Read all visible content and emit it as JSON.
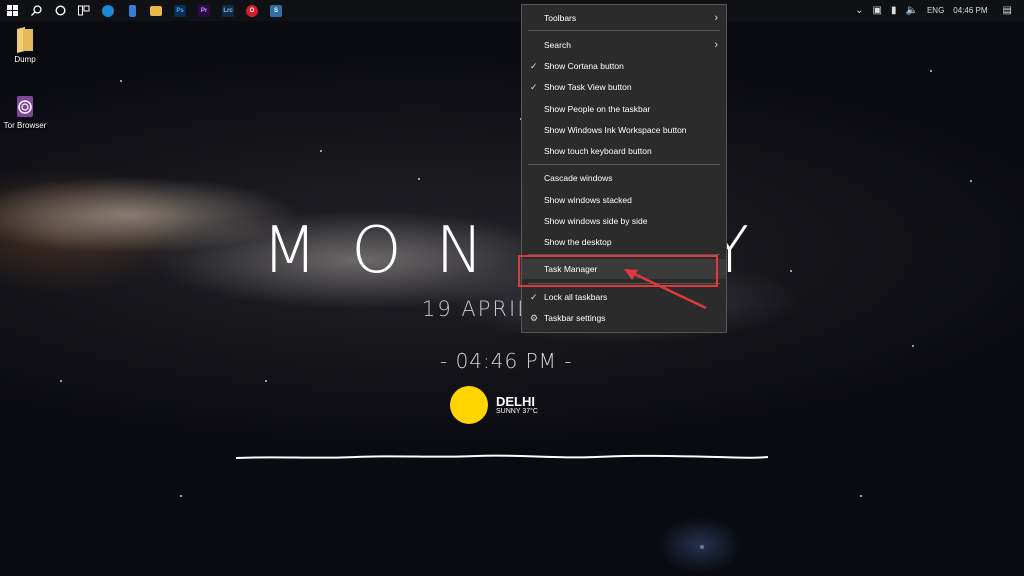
{
  "taskbar": {
    "start_icon": "windows-logo-icon",
    "pinned_apps": [
      {
        "name": "search",
        "icon": "search-icon"
      },
      {
        "name": "cortana",
        "icon": "cortana-circle-icon"
      },
      {
        "name": "task-view",
        "icon": "task-view-icon"
      },
      {
        "name": "edge",
        "icon": "edge-icon",
        "color": "#1c8ad6"
      },
      {
        "name": "phone",
        "icon": "phone-icon",
        "color": "#3a7bd5"
      },
      {
        "name": "file-explorer",
        "icon": "folder-icon",
        "color": "#e8b64a"
      },
      {
        "name": "photoshop",
        "text": "Ps",
        "color": "#0b2a52"
      },
      {
        "name": "premiere",
        "text": "Pr",
        "color": "#2a0a4a"
      },
      {
        "name": "lrc",
        "text": "Lrc",
        "color": "#0f2b45"
      },
      {
        "name": "opera",
        "text": "O",
        "color": "#d11e2c"
      },
      {
        "name": "snip",
        "text": "S",
        "color": "#2f6ea6"
      }
    ],
    "tray": {
      "language": "ENG",
      "time": "04:46 PM"
    }
  },
  "desktop_icons": [
    {
      "label": "Dump",
      "icon": "folder-icon"
    },
    {
      "label": "Tor Browser",
      "icon": "tor-browser-icon"
    }
  ],
  "widget": {
    "day": "MON",
    "day_right_fragment": "Y",
    "date": "19  APRIL,",
    "time": "- 04:46 PM -",
    "city": "DELHI",
    "weather": "SUNNY 37°C",
    "sun_color": "#ffd400"
  },
  "context_menu": {
    "items": [
      {
        "label": "Toolbars",
        "submenu": true
      },
      {
        "label": "Search",
        "submenu": true
      },
      {
        "label": "Show Cortana button",
        "checked": true
      },
      {
        "label": "Show Task View button",
        "checked": true
      },
      {
        "label": "Show People on the taskbar"
      },
      {
        "label": "Show Windows Ink Workspace button"
      },
      {
        "label": "Show touch keyboard button"
      },
      {
        "label": "Cascade windows"
      },
      {
        "label": "Show windows stacked"
      },
      {
        "label": "Show windows side by side"
      },
      {
        "label": "Show the desktop"
      },
      {
        "label": "Task Manager",
        "highlighted": true
      },
      {
        "label": "Lock all taskbars",
        "checked": true
      },
      {
        "label": "Taskbar settings",
        "icon": "gear-icon"
      }
    ]
  },
  "colors": {
    "taskbar_bg": "#101114",
    "menu_bg": "#2b2b2b",
    "highlight_border": "#e0393b"
  }
}
